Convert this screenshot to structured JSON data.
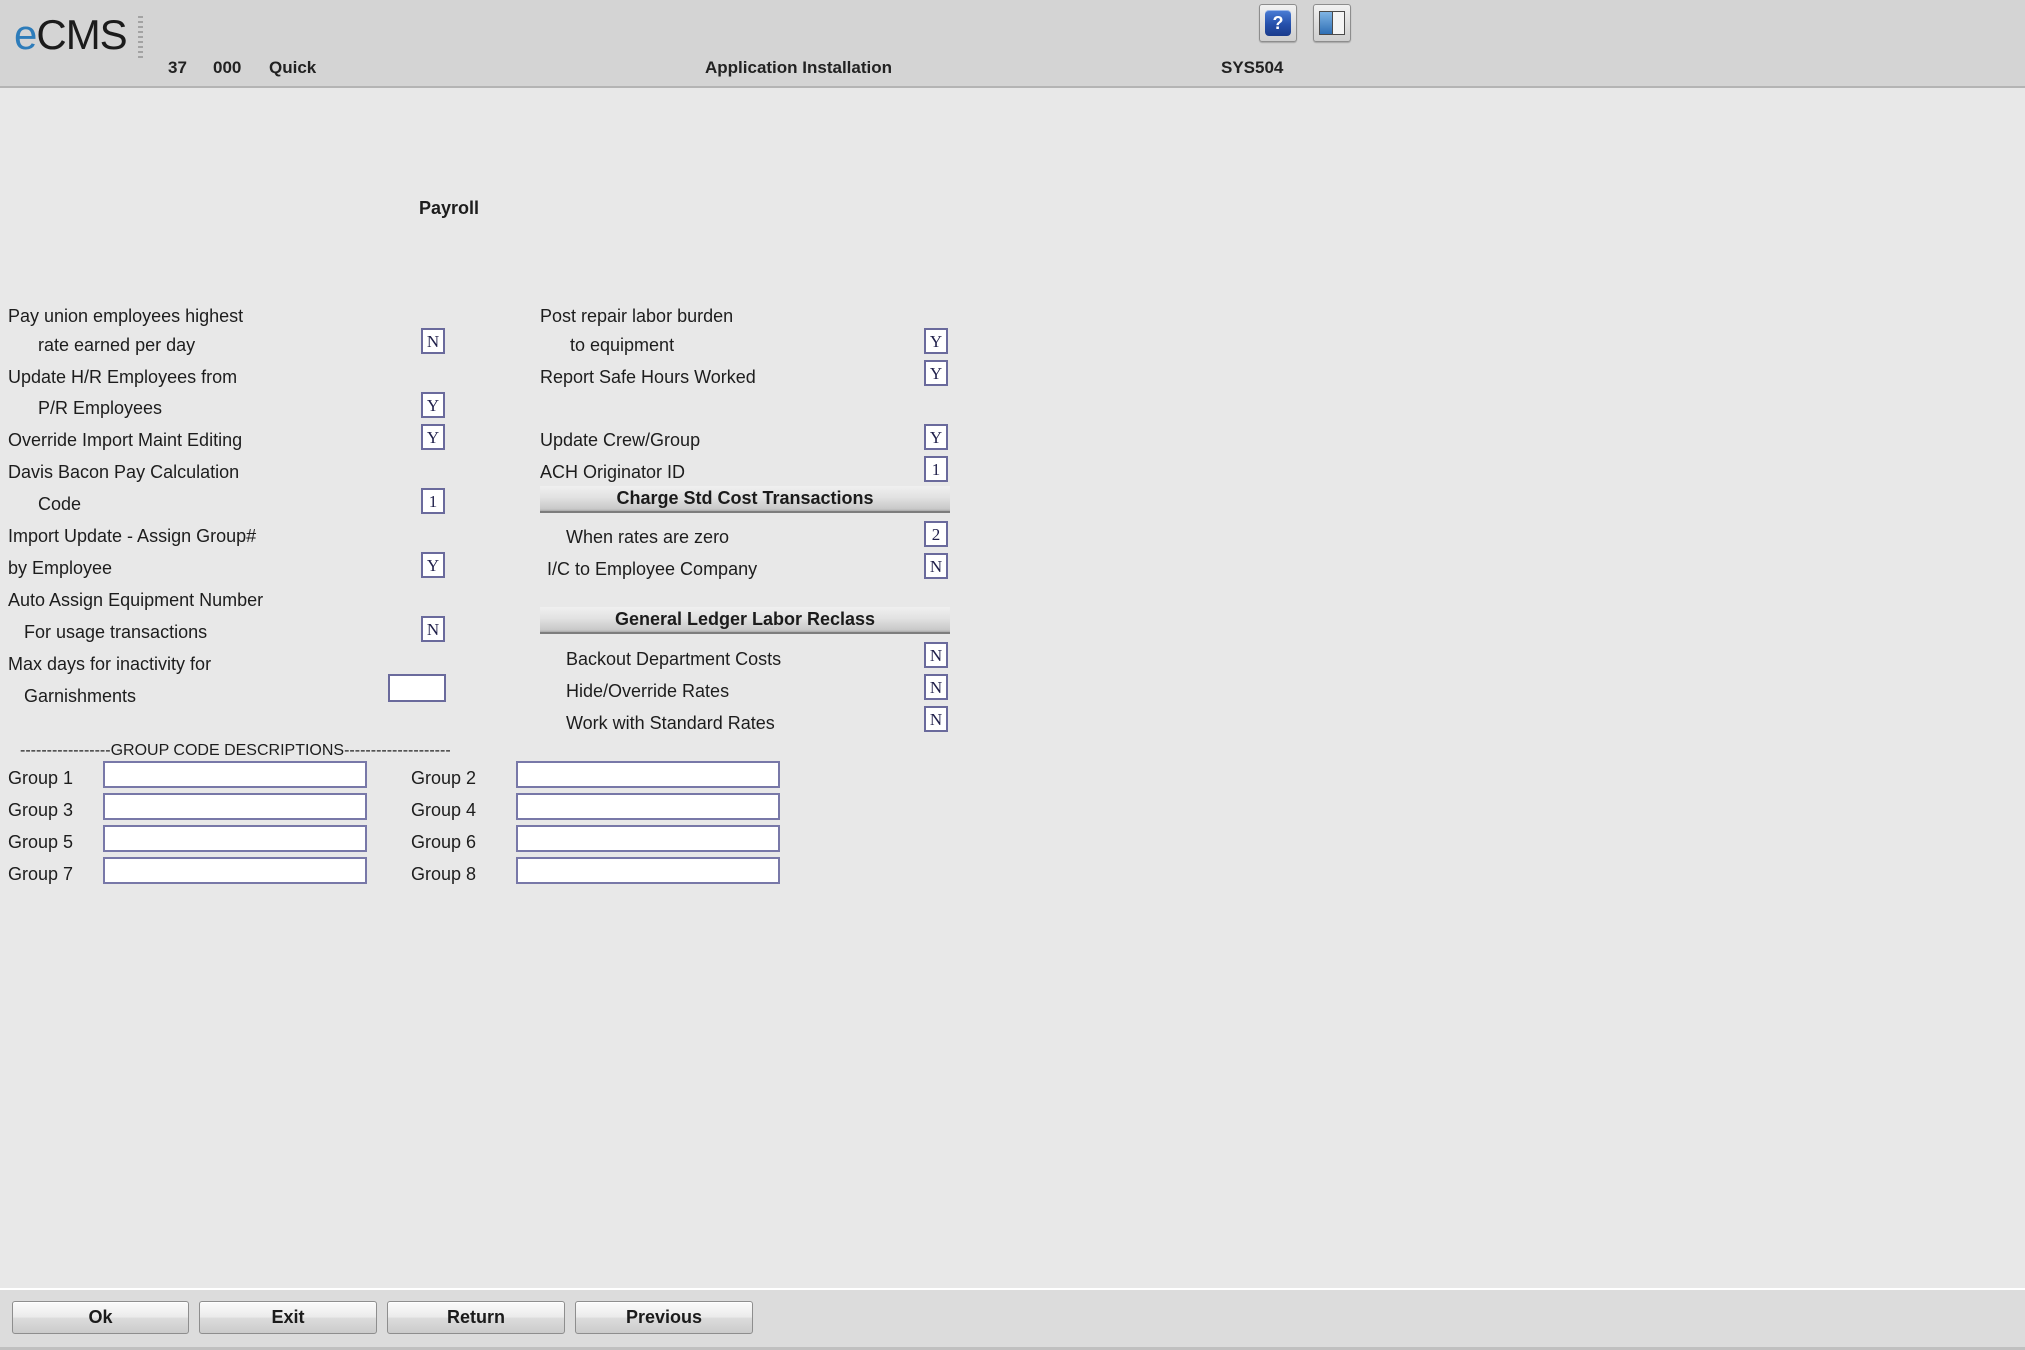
{
  "header": {
    "logo_e": "e",
    "logo_cms": "CMS",
    "company": "37",
    "division": "000",
    "user": "Quick",
    "title": "Application Installation",
    "program_id": "SYS504",
    "help_icon_label": "?",
    "buttons": [
      {
        "name": "help",
        "tooltip": "Help"
      },
      {
        "name": "panel",
        "tooltip": "Window"
      }
    ]
  },
  "form": {
    "column_heading": "Payroll",
    "left_fields": [
      {
        "label": "Pay union employees highest",
        "value": null
      },
      {
        "label": "rate earned per day",
        "value": "N"
      },
      {
        "label": "Update H/R Employees from",
        "value": null
      },
      {
        "label": "P/R Employees",
        "value": "Y"
      },
      {
        "label": "Override Import Maint Editing",
        "value": "Y"
      },
      {
        "label": "Davis Bacon Pay Calculation",
        "value": null
      },
      {
        "label": "Code",
        "value": "1"
      },
      {
        "label": "Import Update - Assign Group#",
        "value": null
      },
      {
        "label": "by Employee",
        "value": "Y"
      },
      {
        "label": "Auto Assign Equipment Number",
        "value": null
      },
      {
        "label": "For usage transactions",
        "value": "N"
      },
      {
        "label": "Max days for inactivity for",
        "value": null
      },
      {
        "label": "Garnishments",
        "value": ""
      }
    ],
    "right_fields": [
      {
        "label": "Post repair labor burden",
        "value": null
      },
      {
        "label": "to equipment",
        "value": "Y"
      },
      {
        "label": "Report Safe Hours Worked",
        "value": "Y"
      },
      {
        "label": "Update Crew/Group",
        "value": "Y"
      },
      {
        "label": "ACH Originator ID",
        "value": "1"
      }
    ],
    "section_charge_std": {
      "title": "Charge Std Cost Transactions",
      "fields": [
        {
          "label": "When rates are zero",
          "value": "2"
        },
        {
          "label": "I/C to Employee Company",
          "value": "N"
        }
      ]
    },
    "section_gl_reclass": {
      "title": "General Ledger Labor Reclass",
      "fields": [
        {
          "label": "Backout Department Costs",
          "value": "N"
        },
        {
          "label": "Hide/Override Rates",
          "value": "N"
        },
        {
          "label": "Work with Standard Rates",
          "value": "N"
        }
      ]
    },
    "group_section": {
      "divider": "-----------------GROUP CODE DESCRIPTIONS--------------------",
      "rows": [
        {
          "left_label": "Group 1",
          "left_value": "",
          "right_label": "Group 2",
          "right_value": ""
        },
        {
          "left_label": "Group 3",
          "left_value": "",
          "right_label": "Group 4",
          "right_value": ""
        },
        {
          "left_label": "Group 5",
          "left_value": "",
          "right_label": "Group 6",
          "right_value": ""
        },
        {
          "left_label": "Group 7",
          "left_value": "",
          "right_label": "Group 8",
          "right_value": ""
        }
      ]
    }
  },
  "footer": {
    "ok": "Ok",
    "exit": "Exit",
    "return": "Return",
    "previous": "Previous"
  },
  "colors": {
    "header_bg": "#d4d4d4",
    "body_bg": "#e8e8e8",
    "footer_bg": "#dcdcdc",
    "logo_blue": "#2d7cba",
    "field_border": "#6a6a9c",
    "help_blue": "#2550ab"
  }
}
